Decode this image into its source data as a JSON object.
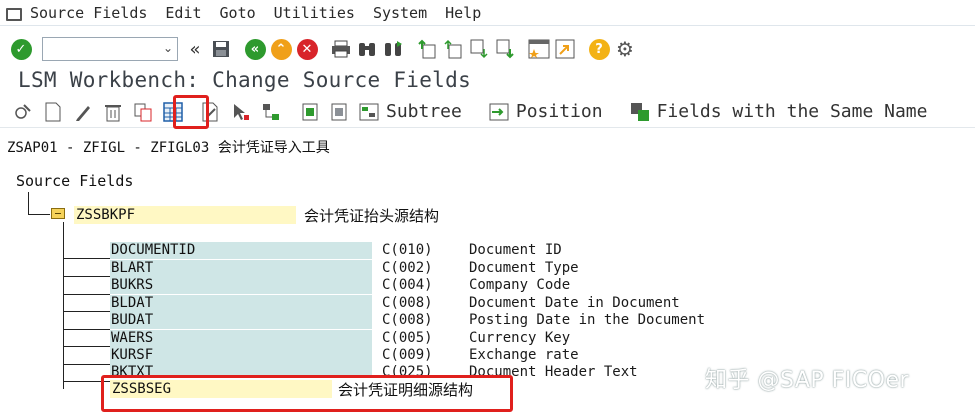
{
  "menu": {
    "items": [
      {
        "label": "Source Fields"
      },
      {
        "label": "Edit"
      },
      {
        "label": "Goto"
      },
      {
        "label": "Utilities"
      },
      {
        "label": "System"
      },
      {
        "label": "Help"
      }
    ]
  },
  "system_toolbar": {
    "command_field_value": "",
    "icons": [
      "enter-icon",
      "save-icon",
      "back-icon",
      "exit-icon",
      "cancel-icon",
      "print-icon",
      "find-icon",
      "find-next-icon",
      "first-page-icon",
      "previous-page-icon",
      "next-page-icon",
      "last-page-icon",
      "create-session-icon",
      "shortcut-icon",
      "help-icon",
      "settings-icon"
    ]
  },
  "title": "LSM Workbench: Change Source Fields",
  "app_toolbar": {
    "subtree_label": "Subtree",
    "position_label": "Position",
    "same_name_label": "Fields with the Same Name"
  },
  "object_path": "ZSAP01 - ZFIGL - ZFIGL03 会计凭证导入工具",
  "tree": {
    "root_label": "Source Fields",
    "header_structure": {
      "name": "ZSSBKPF",
      "description": "会计凭证抬头源结构"
    },
    "fields": [
      {
        "name": "DOCUMENTID",
        "type": "C(010)",
        "description": "Document ID"
      },
      {
        "name": "BLART",
        "type": "C(002)",
        "description": "Document Type"
      },
      {
        "name": "BUKRS",
        "type": "C(004)",
        "description": "Company Code"
      },
      {
        "name": "BLDAT",
        "type": "C(008)",
        "description": "Document Date in Document"
      },
      {
        "name": "BUDAT",
        "type": "C(008)",
        "description": "Posting Date in the Document"
      },
      {
        "name": "WAERS",
        "type": "C(005)",
        "description": "Currency Key"
      },
      {
        "name": "KURSF",
        "type": "C(009)",
        "description": "Exchange rate"
      },
      {
        "name": "BKTXT",
        "type": "C(025)",
        "description": "Document Header Text"
      }
    ],
    "item_structure": {
      "name": "ZSSBSEG",
      "description": "会计凭证明细源结构"
    }
  },
  "watermark": "知乎 @SAP FICOer",
  "colors": {
    "field_bg": "#cfe6e6",
    "structure_bg": "#fff8c4",
    "highlight": "#e0201d",
    "enter_green": "#2e9a2e",
    "nav_green": "#2e9a2e",
    "nav_orange": "#f0a019",
    "nav_red": "#d8242a",
    "help_yellow": "#f3b215"
  }
}
